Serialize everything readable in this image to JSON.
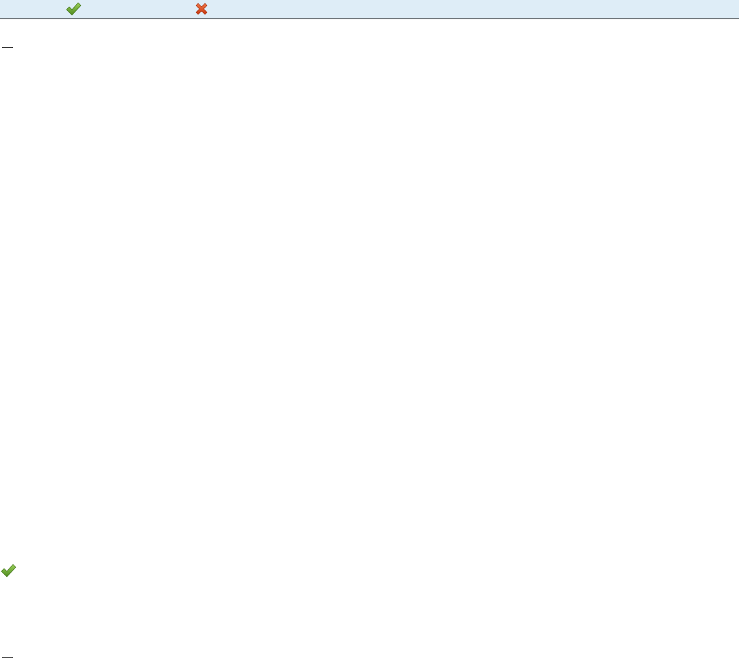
{
  "toolbar": {
    "buttons": [
      {
        "name": "confirm",
        "icon": "checkmark-icon",
        "color": "#6aa32e"
      },
      {
        "name": "cancel",
        "icon": "close-x-icon",
        "color": "#e0531f"
      }
    ],
    "background": "#deedf7"
  },
  "body": {
    "status_icon": "checkmark-icon",
    "status_color": "#6aa32e"
  }
}
